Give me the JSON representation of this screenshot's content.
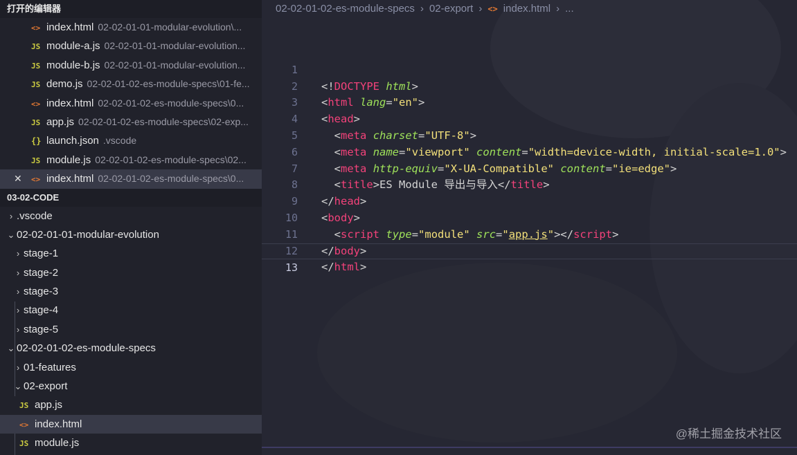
{
  "sidebar": {
    "open_editors_title": "打开的编辑器",
    "open_editors": [
      {
        "icon": "<>",
        "type": "html",
        "name": "index.html",
        "path": "02-02-01-01-modular-evolution\\..."
      },
      {
        "icon": "JS",
        "type": "js",
        "name": "module-a.js",
        "path": "02-02-01-01-modular-evolution..."
      },
      {
        "icon": "JS",
        "type": "js",
        "name": "module-b.js",
        "path": "02-02-01-01-modular-evolution..."
      },
      {
        "icon": "JS",
        "type": "js",
        "name": "demo.js",
        "path": "02-02-01-02-es-module-specs\\01-fe..."
      },
      {
        "icon": "<>",
        "type": "html",
        "name": "index.html",
        "path": "02-02-01-02-es-module-specs\\0..."
      },
      {
        "icon": "JS",
        "type": "js",
        "name": "app.js",
        "path": "02-02-01-02-es-module-specs\\02-exp..."
      },
      {
        "icon": "{}",
        "type": "json",
        "name": "launch.json",
        "path": ".vscode"
      },
      {
        "icon": "JS",
        "type": "js",
        "name": "module.js",
        "path": "02-02-01-02-es-module-specs\\02..."
      },
      {
        "icon": "<>",
        "type": "html",
        "name": "index.html",
        "path": "02-02-01-02-es-module-specs\\0..."
      }
    ],
    "close_glyph": "✕",
    "workspace_title": "03-02-CODE",
    "tree": [
      {
        "label": ".vscode",
        "chev": "›"
      },
      {
        "label": "02-02-01-01-modular-evolution",
        "chev": "⌄"
      },
      {
        "label": "stage-1",
        "chev": "›"
      },
      {
        "label": "stage-2",
        "chev": "›"
      },
      {
        "label": "stage-3",
        "chev": "›"
      },
      {
        "label": "stage-4",
        "chev": "›"
      },
      {
        "label": "stage-5",
        "chev": "›"
      },
      {
        "label": "02-02-01-02-es-module-specs",
        "chev": "⌄"
      },
      {
        "label": "01-features",
        "chev": "›"
      },
      {
        "label": "02-export",
        "chev": "⌄"
      },
      {
        "label": "app.js",
        "icon": "JS"
      },
      {
        "label": "index.html",
        "icon": "<>"
      },
      {
        "label": "module.js",
        "icon": "JS"
      }
    ]
  },
  "breadcrumb": {
    "part1": "02-02-01-02-es-module-specs",
    "sep": "›",
    "part2": "02-export",
    "icon": "<>",
    "part3": "index.html",
    "more": "..."
  },
  "code": {
    "line_numbers": [
      "1",
      "2",
      "3",
      "4",
      "5",
      "6",
      "7",
      "8",
      "9",
      "10",
      "11",
      "12",
      "13"
    ],
    "l1": {
      "open": "<!",
      "doctype": "DOCTYPE",
      "sp": " ",
      "html": "html",
      "close": ">"
    },
    "l2": {
      "open": "<",
      "tag": "html",
      "sp": " ",
      "attr": "lang",
      "eq": "=",
      "val": "\"en\"",
      "close": ">"
    },
    "l3": {
      "open": "<",
      "tag": "head",
      "close": ">"
    },
    "l4": {
      "indent": "  ",
      "open": "<",
      "tag": "meta",
      "sp": " ",
      "attr": "charset",
      "eq": "=",
      "val": "\"UTF-8\"",
      "close": ">"
    },
    "l5": {
      "indent": "  ",
      "open": "<",
      "tag": "meta",
      "sp": " ",
      "attr1": "name",
      "eq": "=",
      "val1": "\"viewport\"",
      "sp2": " ",
      "attr2": "content",
      "val2": "\"width=device-width, initial-scale=1.0\"",
      "close": ">"
    },
    "l6": {
      "indent": "  ",
      "open": "<",
      "tag": "meta",
      "sp": " ",
      "attr1": "http-equiv",
      "eq": "=",
      "val1": "\"X-UA-Compatible\"",
      "sp2": " ",
      "attr2": "content",
      "val2": "\"ie=edge\"",
      "close": ">"
    },
    "l7": {
      "indent": "  ",
      "open": "<",
      "tag": "title",
      "close": ">",
      "text": "ES Module 导出与导入",
      "open2": "</",
      "close2": ">"
    },
    "l8": {
      "open": "</",
      "tag": "head",
      "close": ">"
    },
    "l9": {
      "open": "<",
      "tag": "body",
      "close": ">"
    },
    "l10": {
      "indent": "  ",
      "open": "<",
      "tag": "script",
      "sp": " ",
      "attr1": "type",
      "eq": "=",
      "val1": "\"module\"",
      "sp2": " ",
      "attr2": "src",
      "q": "\"",
      "link": "app.js",
      "close": ">",
      "open2": "</",
      "close2": ">"
    },
    "l11": {
      "open": "</",
      "tag": "body",
      "close": ">"
    },
    "l12": {
      "open": "</",
      "tag": "html",
      "close": ">"
    }
  },
  "watermark": "@稀土掘金技术社区"
}
